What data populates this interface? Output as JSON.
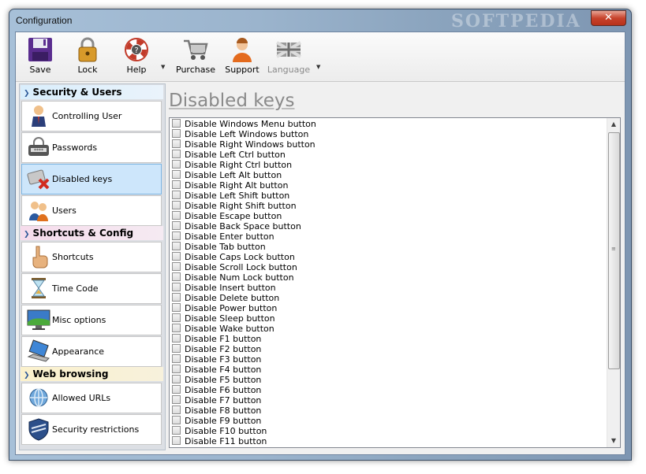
{
  "window": {
    "title": "Configuration",
    "close_label": "✕",
    "watermark": "SOFTPEDIA"
  },
  "toolbar": {
    "save": "Save",
    "lock": "Lock",
    "help": "Help",
    "purchase": "Purchase",
    "support": "Support",
    "language": "Language",
    "dropdown_glyph": "▼"
  },
  "sidebar": {
    "groups": [
      {
        "title": "Security & Users",
        "items": [
          "Controlling User",
          "Passwords",
          "Disabled keys",
          "Users"
        ]
      },
      {
        "title": "Shortcuts & Config",
        "items": [
          "Shortcuts",
          "Time Code",
          "Misc options",
          "Appearance"
        ]
      },
      {
        "title": "Web browsing",
        "items": [
          "Allowed URLs",
          "Security restrictions"
        ]
      }
    ],
    "selected": "Disabled keys"
  },
  "content": {
    "title": "Disabled keys",
    "options": [
      "Disable Windows Menu button",
      "Disable Left Windows button",
      "Disable Right Windows button",
      "Disable Left Ctrl button",
      "Disable Right Ctrl button",
      "Disable Left Alt button",
      "Disable Right Alt button",
      "Disable Left Shift button",
      "Disable Right Shift button",
      "Disable Escape button",
      "Disable Back Space button",
      "Disable Enter button",
      "Disable Tab button",
      "Disable Caps Lock button",
      "Disable Scroll Lock button",
      "Disable Num Lock button",
      "Disable Insert button",
      "Disable Delete button",
      "Disable Power button",
      "Disable Sleep button",
      "Disable Wake button",
      "Disable F1 button",
      "Disable F2 button",
      "Disable F3 button",
      "Disable F4 button",
      "Disable F5 button",
      "Disable F6 button",
      "Disable F7 button",
      "Disable F8 button",
      "Disable F9 button",
      "Disable F10 button",
      "Disable F11 button"
    ],
    "scroll_up": "▲",
    "scroll_down": "▼",
    "scroll_grip": "≡"
  },
  "colors": {
    "selected_item": "#cde6fb",
    "close_button": "#c7432c",
    "title_gray": "#8a8a8a"
  }
}
